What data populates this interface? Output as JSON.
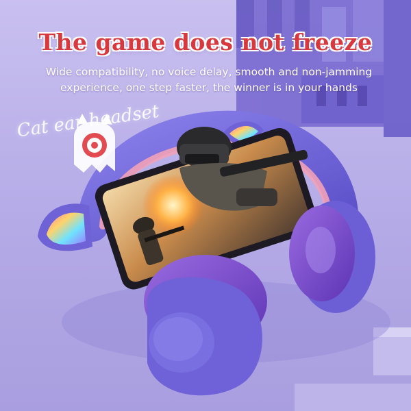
{
  "headline": "The game does not freeze",
  "subtext_line1": "Wide compatibility, no voice delay, smooth and non-jamming",
  "subtext_line2": "experience, one step faster, the winner is in your hands",
  "product_label": "Cat ear headset",
  "icons": {
    "mascot": "ghost-cat-icon",
    "headset": "cat-ear-headset",
    "phone": "smartphone-game-screen"
  },
  "colors": {
    "background": "#b7aee6",
    "headline": "#d8393f",
    "headset": "#6d5fd8",
    "cushion": "#7b4fd0",
    "accent_pink": "#f2a2b8"
  }
}
